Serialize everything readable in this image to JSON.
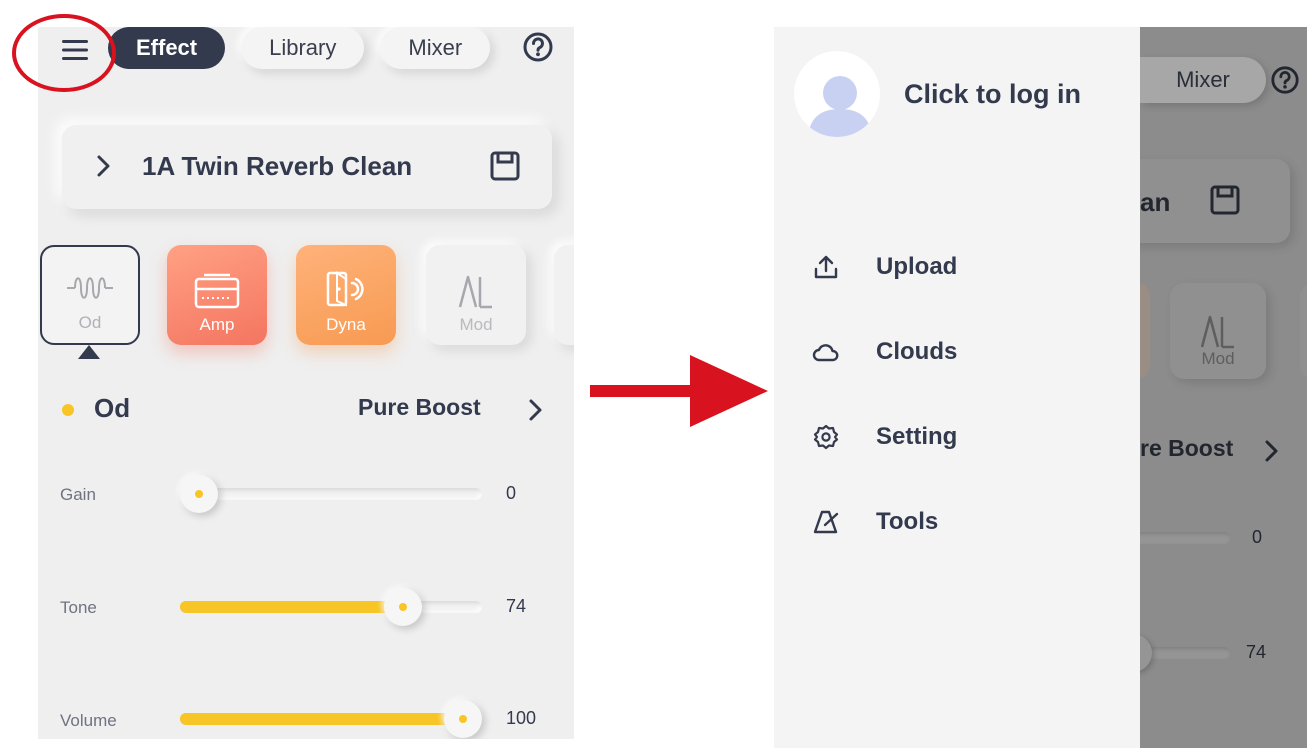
{
  "left_screen": {
    "tabs": [
      {
        "label": "Effect",
        "active": true
      },
      {
        "label": "Library",
        "active": false
      },
      {
        "label": "Mixer",
        "active": false
      }
    ],
    "preset": {
      "name": "1A Twin Reverb Clean"
    },
    "modules": [
      {
        "label": "Od",
        "icon": "od-waveform-icon",
        "selected": true
      },
      {
        "label": "Amp",
        "icon": "amp-icon",
        "color": "#f47560"
      },
      {
        "label": "Dyna",
        "icon": "dyna-icon",
        "color": "#f79a52"
      },
      {
        "label": "Mod",
        "icon": "mod-icon"
      }
    ],
    "effect": {
      "module": "Od",
      "name": "Pure Boost",
      "params": [
        {
          "label": "Gain",
          "value": "0",
          "level": 0
        },
        {
          "label": "Tone",
          "value": "74",
          "level": 0.74
        },
        {
          "label": "Volume",
          "value": "100",
          "level": 1.0
        }
      ]
    }
  },
  "drawer": {
    "login_text": "Click to log in",
    "items": [
      {
        "label": "Upload",
        "icon": "upload-icon"
      },
      {
        "label": "Clouds",
        "icon": "cloud-icon"
      },
      {
        "label": "Setting",
        "icon": "gear-icon"
      },
      {
        "label": "Tools",
        "icon": "metronome-icon"
      }
    ]
  },
  "right_backdrop": {
    "tab_label": "Mixer",
    "preset_fragment": "an",
    "module_label": "Mod",
    "effect_fragment": "re Boost",
    "values": [
      "0",
      "74"
    ]
  },
  "colors": {
    "accent_yellow": "#f8c526",
    "dark_navy": "#333a4d",
    "annotation_red": "#d9121f",
    "amp_color": "#f47560",
    "dyna_color": "#f79a52"
  }
}
